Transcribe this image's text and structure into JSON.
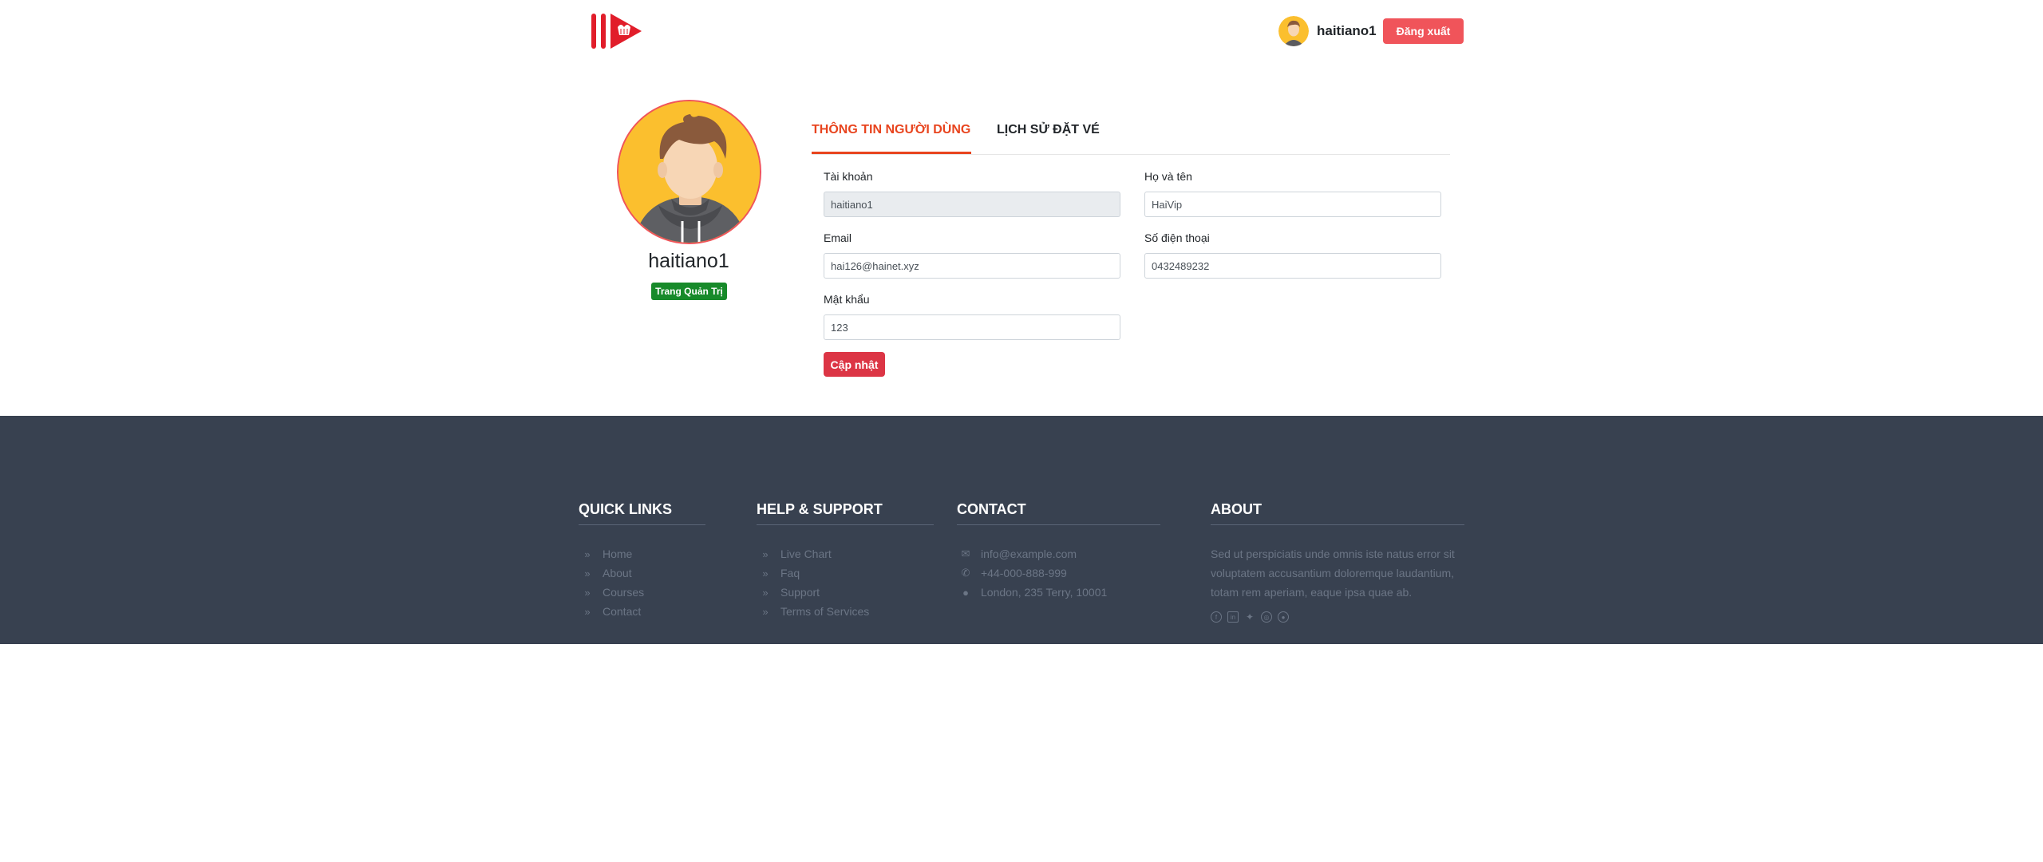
{
  "header": {
    "user_name": "haitiano1",
    "logout_label": "Đăng xuất"
  },
  "profile": {
    "name": "haitiano1",
    "badge": "Trang Quản Trị"
  },
  "tabs": [
    {
      "label": "THÔNG TIN NGƯỜI DÙNG",
      "active": true
    },
    {
      "label": "LỊCH SỬ ĐẶT VÉ",
      "active": false
    }
  ],
  "form": {
    "account_label": "Tài khoản",
    "account_value": "haitiano1",
    "fullname_label": "Họ và tên",
    "fullname_value": "HaiVip",
    "email_label": "Email",
    "email_value": "hai126@hainet.xyz",
    "phone_label": "Số điện thoại",
    "phone_value": "0432489232",
    "password_label": "Mật khẩu",
    "password_value": "123",
    "update_label": "Cập nhật"
  },
  "footer": {
    "quick_links": {
      "heading": "QUICK LINKS",
      "items": [
        "Home",
        "About",
        "Courses",
        "Contact"
      ]
    },
    "help": {
      "heading": "HELP & SUPPORT",
      "items": [
        "Live Chart",
        "Faq",
        "Support",
        "Terms of Services"
      ]
    },
    "contact": {
      "heading": "CONTACT",
      "email": "info@example.com",
      "phone": "+44-000-888-999",
      "address": "London, 235 Terry, 10001"
    },
    "about": {
      "heading": "ABOUT",
      "text": "Sed ut perspiciatis unde omnis iste natus error sit voluptatem accusantium doloremque laudantium, totam rem aperiam, eaque ipsa quae ab."
    },
    "socials": [
      "facebook-icon",
      "linkedin-icon",
      "twitter-icon",
      "dribbble-icon",
      "github-icon"
    ]
  },
  "colors": {
    "accent": "#e8441e",
    "logout": "#f0545a",
    "update": "#dc3545",
    "badge": "#178a2a",
    "footer_bg": "#384150"
  }
}
